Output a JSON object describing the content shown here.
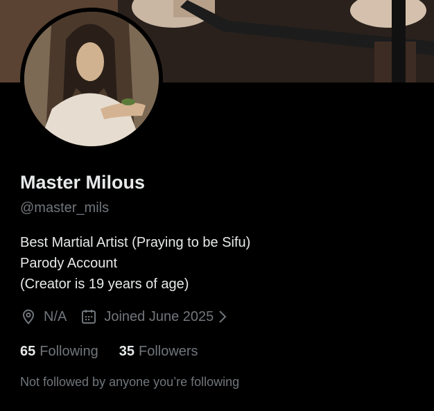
{
  "profile": {
    "display_name": "Master Milous",
    "handle": "@master_mils",
    "bio_lines": [
      "Best Martial Artist (Praying to be Sifu)",
      "Parody Account",
      "(Creator is 19 years of age)"
    ],
    "location": "N/A",
    "joined": "Joined June 2025",
    "following_count": "65",
    "following_label": "Following",
    "followers_count": "35",
    "followers_label": "Followers",
    "followed_by_note": "Not followed by anyone you’re following"
  },
  "icons": {
    "location": "location-pin-icon",
    "calendar": "calendar-icon",
    "chevron": "chevron-right-icon"
  },
  "colors": {
    "background": "#000000",
    "primary_text": "#e7e9ea",
    "secondary_text": "#71767b"
  }
}
